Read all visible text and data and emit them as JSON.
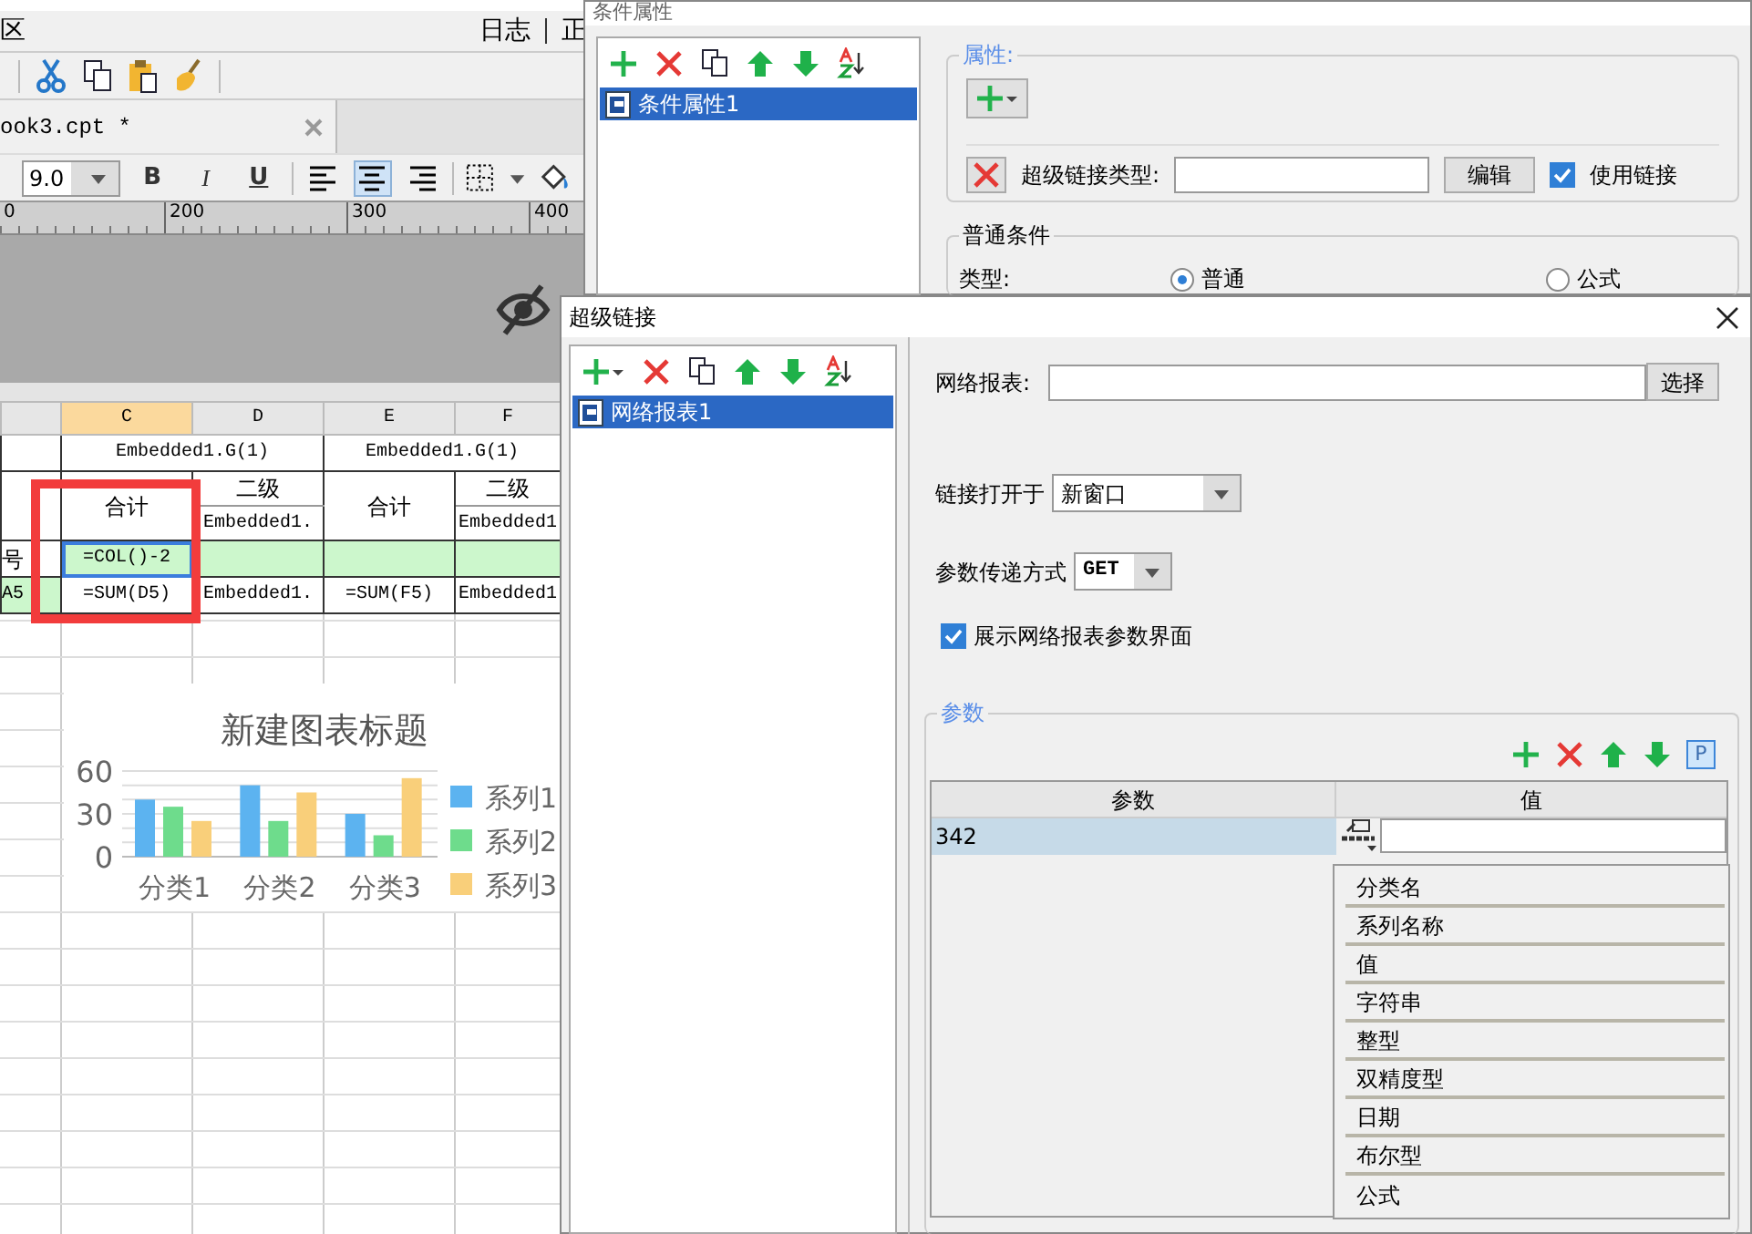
{
  "editor": {
    "menu_items": [
      "区",
      "日志",
      "正"
    ],
    "file_tab": {
      "title": "ook3.cpt *"
    },
    "font_size": "9.0",
    "text_styles": [
      {
        "label": "B",
        "kind": "bold"
      },
      {
        "label": "I",
        "kind": "italic"
      },
      {
        "label": "U",
        "kind": "underline"
      }
    ],
    "align_buttons": [
      {
        "kind": "left",
        "selected": false
      },
      {
        "kind": "center",
        "selected": true
      },
      {
        "kind": "right",
        "selected": false
      }
    ],
    "ruler_labels": [
      "0",
      "200",
      "300",
      "400"
    ],
    "sheet": {
      "columns": [
        {
          "label": "C",
          "selected": true
        },
        {
          "label": "D",
          "selected": false
        },
        {
          "label": "E",
          "selected": false
        },
        {
          "label": "F",
          "selected": false
        }
      ],
      "group_headers": [
        "Embedded1.G(1)",
        "Embedded1.G(1)"
      ],
      "groups": [
        {
          "total": "合计",
          "sub_title": "二级",
          "field": "Embedded1."
        },
        {
          "total": "合计",
          "sub_title": "二级",
          "field": "Embedded1"
        }
      ],
      "row_labels": [
        "号",
        "A5"
      ],
      "formula": "=COL()-2",
      "sum_row": [
        "=SUM(D5)",
        "Embedded1.",
        "=SUM(F5)",
        "Embedded1"
      ]
    },
    "chart": {
      "chart_data": {
        "type": "bar",
        "legend": "right",
        "title": "新建图表标题",
        "categories": [
          "分类1",
          "分类2",
          "分类3"
        ],
        "ylim": [
          0,
          60
        ],
        "yticks": [
          0,
          30,
          60
        ],
        "series": [
          {
            "name": "系列1",
            "color": "#5cb3f0",
            "values": [
              40,
              50,
              30
            ]
          },
          {
            "name": "系列2",
            "color": "#6edc8c",
            "values": [
              35,
              25,
              15
            ]
          },
          {
            "name": "系列3",
            "color": "#f9cf7a",
            "values": [
              25,
              45,
              55
            ]
          }
        ]
      }
    }
  },
  "condition_dialog": {
    "title": "条件属性",
    "items": [
      {
        "label": "条件属性1",
        "selected": true
      }
    ],
    "properties_legend": "属性:",
    "link_type_label": "超级链接类型:",
    "edit_button": "编辑",
    "use_link": {
      "label": "使用链接",
      "checked": true
    },
    "condition_legend": "普通条件",
    "type_label": "类型:",
    "type_options": [
      {
        "label": "普通",
        "selected": true
      },
      {
        "label": "公式",
        "selected": false
      }
    ]
  },
  "hyperlink_dialog": {
    "title": "超级链接",
    "items": [
      {
        "label": "网络报表1",
        "selected": true
      }
    ],
    "report_label": "网络报表:",
    "select_button": "选择",
    "open_in": {
      "label": "链接打开于",
      "value": "新窗口"
    },
    "param_method": {
      "label": "参数传递方式",
      "value": "GET"
    },
    "show_params": {
      "label": "展示网络报表参数界面",
      "checked": true
    },
    "params_legend": "参数",
    "p_button": "P",
    "param_table": {
      "columns": [
        "参数",
        "值"
      ],
      "rows": [
        {
          "name": "342",
          "selected": true
        }
      ]
    },
    "value_menu": [
      "分类名",
      "系列名称",
      "值",
      "字符串",
      "整型",
      "双精度型",
      "日期",
      "布尔型",
      "公式"
    ]
  }
}
